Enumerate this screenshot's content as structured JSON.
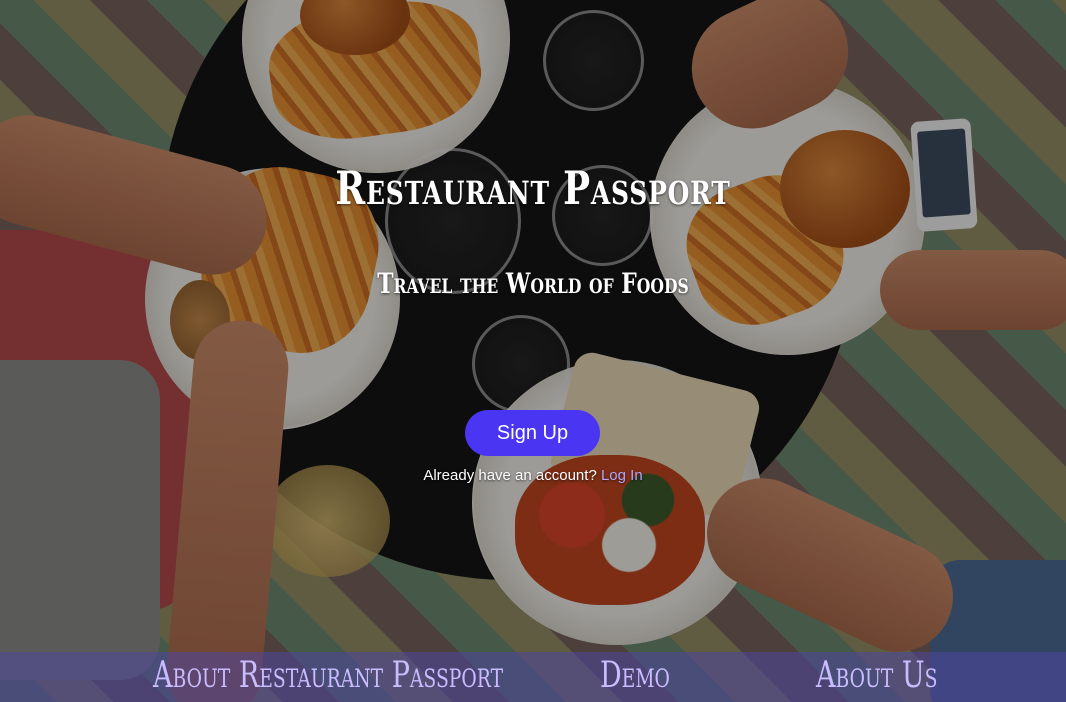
{
  "hero": {
    "title": "Restaurant Passport",
    "subtitle": "Travel the World of Foods",
    "signup_label": "Sign Up",
    "login_prompt": "Already have an account?",
    "login_label": "Log In"
  },
  "footer_nav": {
    "items": [
      {
        "label": "About Restaurant Passport"
      },
      {
        "label": "Demo"
      },
      {
        "label": "About Us"
      }
    ]
  },
  "colors": {
    "signup_button": "#4a35f2",
    "link": "#b3a6ff",
    "nav_text": "#c9bcff",
    "nav_bar": "#4e46a0"
  }
}
